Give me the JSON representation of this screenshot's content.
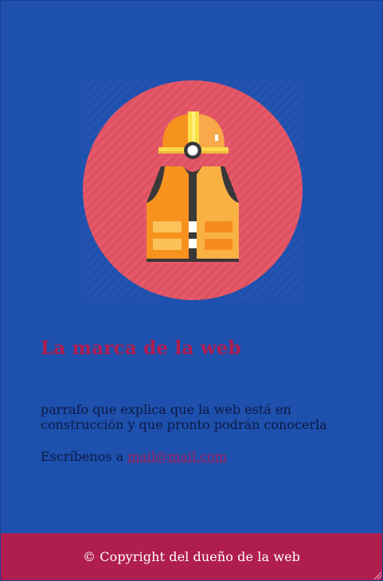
{
  "illustration": {
    "icon": "construction-worker-vest-helmet-icon",
    "circle_color": "#e05162",
    "helmet_color": "#f5921e",
    "vest_color": "#f7921e"
  },
  "brand": {
    "title": "La marca de la web",
    "color": "#b01e50"
  },
  "content": {
    "paragraph": "parrafo que explica que la web está en construcción y que pronto podrán conocerla",
    "contact_prefix": "Escríbenos a ",
    "contact_email": "mail@mail.com"
  },
  "footer": {
    "text": "© Copyright del dueño de la web",
    "background": "#b01e50"
  },
  "colors": {
    "page_background": "#1e50ad",
    "text": "#0c1a44"
  }
}
